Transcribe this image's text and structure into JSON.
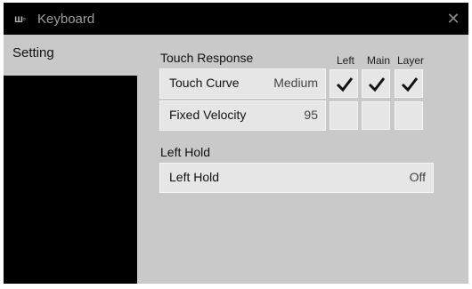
{
  "window": {
    "title": "Keyboard",
    "close_icon": "close-icon"
  },
  "sidebar": {
    "tab_label": "Setting"
  },
  "touch_response": {
    "title": "Touch Response",
    "columns": [
      "Left",
      "Main",
      "Layer"
    ],
    "rows": [
      {
        "label": "Touch Curve",
        "value": "Medium",
        "checks": [
          true,
          true,
          true
        ]
      },
      {
        "label": "Fixed Velocity",
        "value": "95",
        "checks": [
          false,
          false,
          false
        ]
      }
    ]
  },
  "left_hold": {
    "title": "Left Hold",
    "row": {
      "label": "Left Hold",
      "value": "Off"
    }
  }
}
